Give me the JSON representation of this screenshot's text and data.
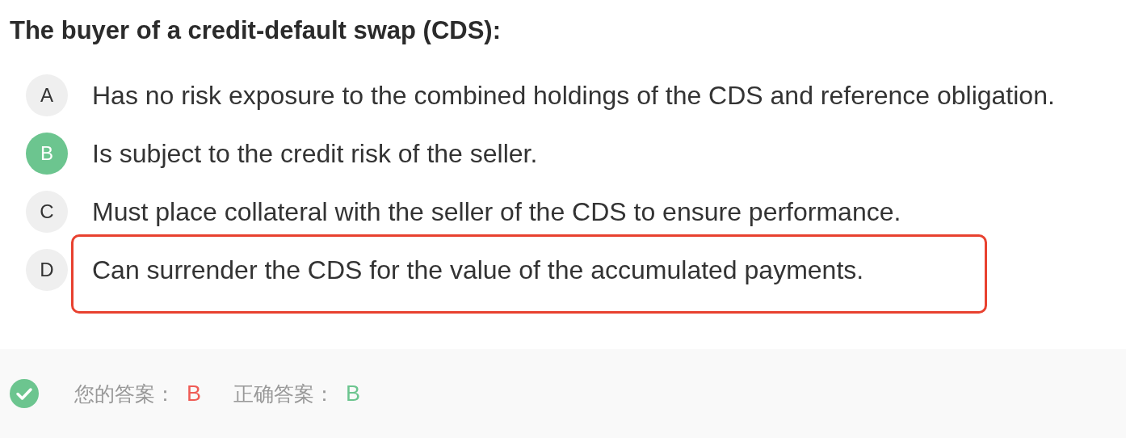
{
  "question": "The buyer of a credit-default swap (CDS):",
  "options": [
    {
      "letter": "A",
      "text": "Has no risk exposure to the combined holdings of the CDS and reference obligation.",
      "selected": false,
      "highlighted": false
    },
    {
      "letter": "B",
      "text": "Is subject to the credit risk of the seller.",
      "selected": true,
      "highlighted": false
    },
    {
      "letter": "C",
      "text": "Must place collateral with the seller of the CDS to ensure performance.",
      "selected": false,
      "highlighted": false
    },
    {
      "letter": "D",
      "text": "Can surrender the CDS for the value of the accumulated payments.",
      "selected": false,
      "highlighted": true
    }
  ],
  "result": {
    "correct": true,
    "your_answer_label": "您的答案：",
    "your_answer": "B",
    "correct_answer_label": "正确答案：",
    "correct_answer": "B"
  }
}
